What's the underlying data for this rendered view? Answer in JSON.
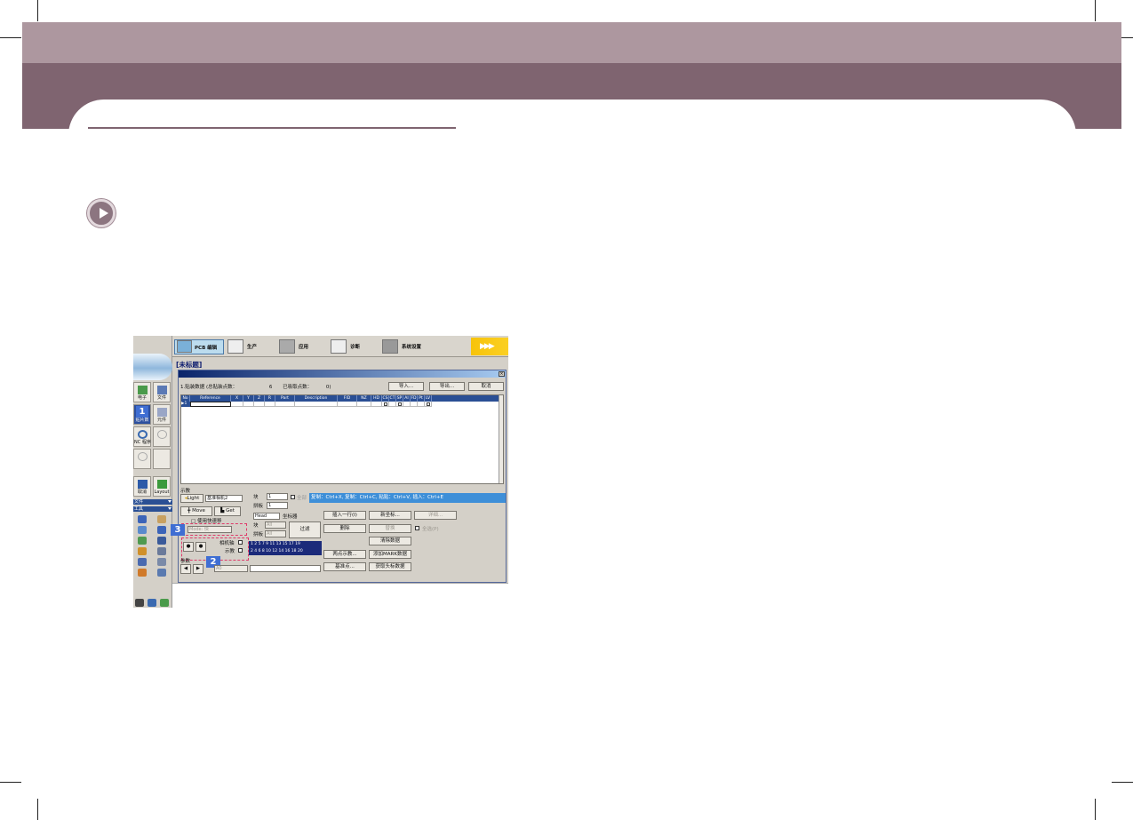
{
  "screen": {
    "window_title": "[未标题]",
    "toolbar": [
      {
        "id": "pcb",
        "label": "PCB 编辑",
        "icon": "pcb-edit-icon"
      },
      {
        "id": "production",
        "label": "生产",
        "icon": "production-icon"
      },
      {
        "id": "application",
        "label": "应用",
        "icon": "application-icon"
      },
      {
        "id": "diagnose",
        "label": "诊断",
        "icon": "diagnose-icon"
      },
      {
        "id": "settings",
        "label": "系统设置",
        "icon": "system-settings-icon"
      }
    ],
    "status": {
      "arrows": "▶▶▶",
      "state": "IDLE"
    },
    "sidebar": {
      "buttons": [
        {
          "label": "电子",
          "icon": "board-icon"
        },
        {
          "label": "文件",
          "icon": "file-icon"
        },
        {
          "label": "贴片数",
          "icon": "placement-icon",
          "badge": "1"
        },
        {
          "label": "元件",
          "icon": "component-icon"
        },
        {
          "label": "NC 程序",
          "icon": "nc-program-icon"
        },
        {
          "label": "",
          "icon": "search-icon"
        },
        {
          "label": "",
          "icon": "feeder-icon"
        },
        {
          "label": "",
          "icon": "blank-icon"
        },
        {
          "label": "取消",
          "icon": "cancel-icon"
        },
        {
          "label": "Layout",
          "icon": "layout-icon"
        }
      ],
      "section_file": "文件",
      "section_tools": "工具"
    },
    "dialog": {
      "close": "×",
      "info": {
        "prefix": "1.贴装数据",
        "total_label": "(总贴装点数：",
        "total": "6",
        "done_label": "已吸取点数：",
        "done": "0)"
      },
      "buttons": {
        "import": "导入...",
        "export": "导出...",
        "cancel": "取消"
      },
      "columns": [
        "No",
        "Reference",
        "X",
        "Y",
        "Z",
        "R",
        "Part",
        "Description",
        "FID",
        "NZ",
        "HD",
        "CS",
        "CT",
        "SP",
        "AI",
        "FD",
        "Pt",
        "LV"
      ],
      "row": {
        "marker": "▶",
        "no": "1"
      },
      "lower_label": "示教",
      "light_label": "Light",
      "light_mode": "基准相机2",
      "move_label": "Move",
      "get_label": "Get",
      "block_label": "块",
      "block_value": "1",
      "panel_label": "拼板",
      "panel_value": "1",
      "all_label": "全部",
      "head_value": "Head",
      "coord_label": "坐标器",
      "use_fast": "□ 使用快速移",
      "speed_mode": "Mode: 快",
      "block2_label": "块",
      "panel2_label": "拼板",
      "block2_value": "All",
      "panel2_value": "All",
      "filter_btn": "过滤",
      "camera_label": "相机轴",
      "teach_label": "示教",
      "num_row1": "1  2  5  7  9  11 13 15 17 19",
      "num_row2": "2  4  6  8  10 12 14 16 18 20",
      "ref_label": "参数",
      "ref_value": "A0",
      "hint": "复制：Ctrl+X, 复制：Ctrl+C, 粘贴：Ctrl+V, 插入：Ctrl+E",
      "actions": {
        "insert": "插入一行(I)",
        "new_coord": "新坐标...",
        "details": "详细...",
        "delete": "删除",
        "replace": "替换",
        "check_all": "全选(P)",
        "clear": "清除数据",
        "two_point": "两点示教...",
        "ref_point": "基准点...",
        "add_mark": "添加MARK数据",
        "get_mark": "获取头标数据"
      }
    },
    "callouts": [
      "1",
      "2",
      "3"
    ]
  }
}
